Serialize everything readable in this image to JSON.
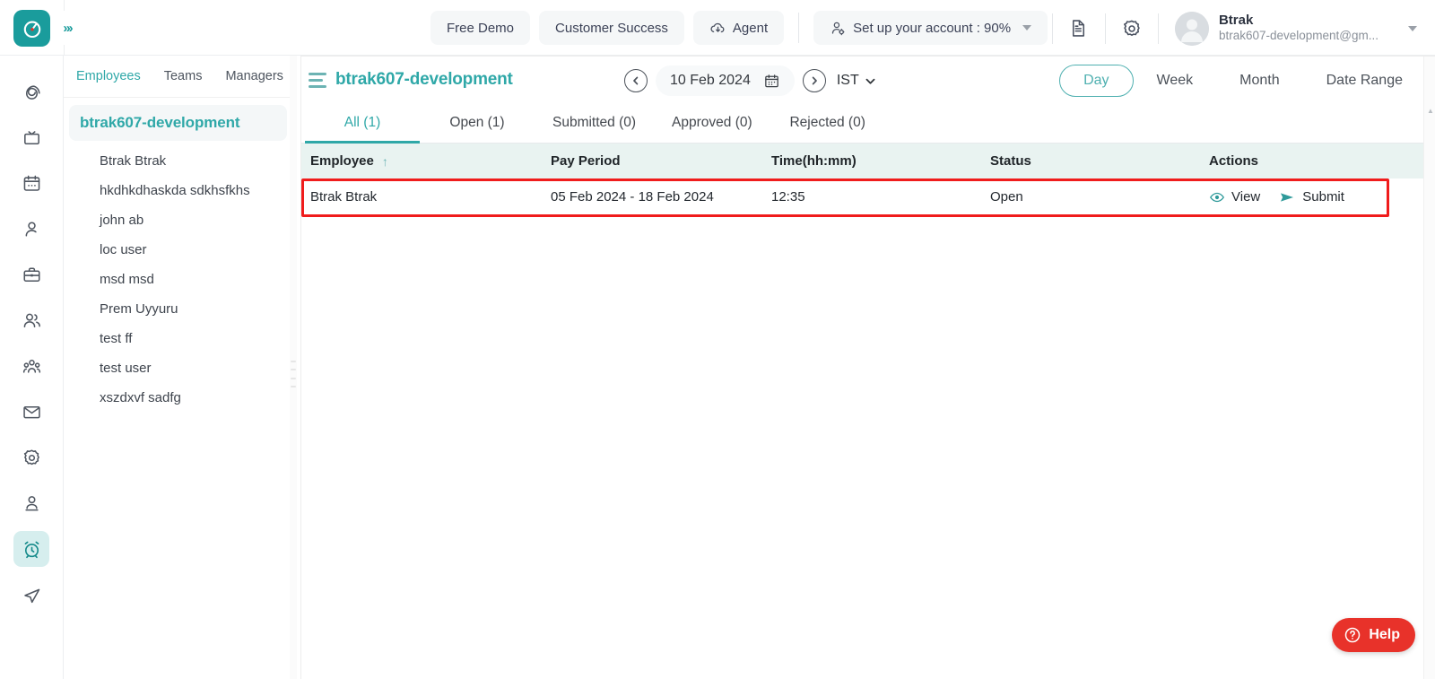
{
  "brand": {
    "logo_icon": "clock-logo-icon",
    "accent": "#1a9c9c",
    "expand_icon": "double-chevron-right-icon"
  },
  "topbar": {
    "nav_buttons": [
      {
        "label": "Free Demo",
        "icon": null
      },
      {
        "label": "Customer Success",
        "icon": null
      },
      {
        "label": "Agent",
        "icon": "cloud-download-icon"
      }
    ],
    "setup_account": {
      "label": "Set up your account : 90%",
      "icon": "user-gear-icon",
      "caret": "chevron-down-icon"
    },
    "doc_icon": "document-icon",
    "settings_icon": "gear-icon",
    "user": {
      "name": "Btrak",
      "email": "btrak607-development@gm...",
      "avatar": "avatar",
      "caret": "chevron-down-icon"
    }
  },
  "rail": {
    "items": [
      {
        "name": "dashboard",
        "icon": "spiral-icon",
        "active": false
      },
      {
        "name": "projects",
        "icon": "tv-board-icon",
        "active": false
      },
      {
        "name": "calendar",
        "icon": "calendar-icon",
        "active": false
      },
      {
        "name": "profile",
        "icon": "user-icon",
        "active": false
      },
      {
        "name": "briefcase",
        "icon": "briefcase-icon",
        "active": false
      },
      {
        "name": "users",
        "icon": "two-users-icon",
        "active": false
      },
      {
        "name": "teams",
        "icon": "group-people-icon",
        "active": false
      },
      {
        "name": "mail",
        "icon": "envelope-icon",
        "active": false
      },
      {
        "name": "settings",
        "icon": "gear-icon",
        "active": false
      },
      {
        "name": "account",
        "icon": "person-badge-icon",
        "active": false
      },
      {
        "name": "timesheet",
        "icon": "alarm-clock-icon",
        "active": true
      },
      {
        "name": "send",
        "icon": "paper-plane-icon",
        "active": false
      }
    ]
  },
  "employee_panel": {
    "tabs": [
      {
        "label": "Employees",
        "active": true
      },
      {
        "label": "Teams",
        "active": false
      },
      {
        "label": "Managers",
        "active": false
      }
    ],
    "group_label": "btrak607-development",
    "employees": [
      "Btrak Btrak",
      "hkdhkdhaskda sdkhsfkhs",
      "john ab",
      "loc user",
      "msd msd",
      "Prem Uyyuru",
      "test ff",
      "test user",
      "xszdxvf sadfg"
    ]
  },
  "main": {
    "menu_icon": "hamburger-icon",
    "title": "btrak607-development",
    "date_nav": {
      "prev_icon": "chevron-left-circle-icon",
      "next_icon": "chevron-right-circle-icon",
      "date": "10 Feb 2024",
      "calendar_icon": "calendar-icon",
      "timezone": "IST",
      "timezone_caret": "chevron-down-icon"
    },
    "view_options": [
      {
        "label": "Day",
        "active": true
      },
      {
        "label": "Week",
        "active": false
      },
      {
        "label": "Month",
        "active": false
      },
      {
        "label": "Date Range",
        "active": false
      }
    ],
    "status_tabs": [
      {
        "label": "All (1)",
        "active": true
      },
      {
        "label": "Open (1)",
        "active": false
      },
      {
        "label": "Submitted (0)",
        "active": false
      },
      {
        "label": "Approved (0)",
        "active": false
      },
      {
        "label": "Rejected (0)",
        "active": false
      }
    ],
    "table": {
      "columns": [
        "Employee",
        "Pay Period",
        "Time(hh:mm)",
        "Status",
        "Actions"
      ],
      "sort_column": "Employee",
      "sort_icon": "sort-ascending-arrow-icon",
      "rows": [
        {
          "employee": "Btrak Btrak",
          "pay_period": "05 Feb 2024 - 18 Feb 2024",
          "time": "12:35",
          "status": "Open",
          "actions": [
            {
              "label": "View",
              "icon": "eye-icon"
            },
            {
              "label": "Submit",
              "icon": "send-arrow-icon"
            }
          ],
          "highlighted": true,
          "highlight_color": "#f01c1c"
        }
      ]
    }
  },
  "help": {
    "label": "Help",
    "icon": "question-mark-circle-icon",
    "color": "#e8322a"
  }
}
